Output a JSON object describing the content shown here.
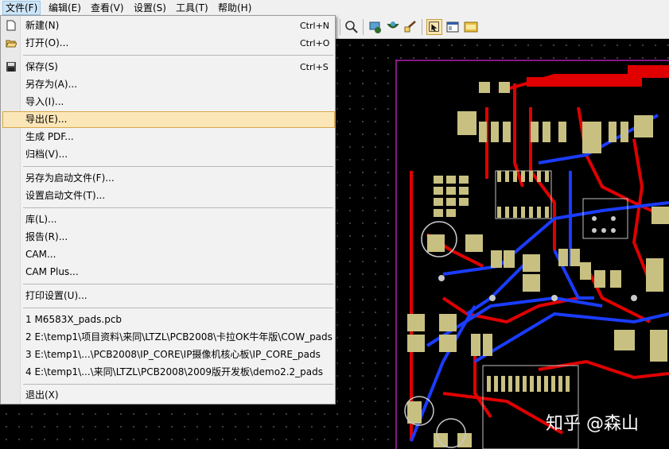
{
  "menubar": {
    "items": [
      {
        "label": "文件(F)"
      },
      {
        "label": "编辑(E)"
      },
      {
        "label": "查看(V)"
      },
      {
        "label": "设置(S)"
      },
      {
        "label": "工具(T)"
      },
      {
        "label": "帮助(H)"
      }
    ]
  },
  "file_menu": {
    "new": {
      "label": "新建(N)",
      "shortcut": "Ctrl+N"
    },
    "open": {
      "label": "打开(O)...",
      "shortcut": "Ctrl+O"
    },
    "save": {
      "label": "保存(S)",
      "shortcut": "Ctrl+S"
    },
    "save_as": {
      "label": "另存为(A)..."
    },
    "import": {
      "label": "导入(I)..."
    },
    "export": {
      "label": "导出(E)..."
    },
    "generate_pdf": {
      "label": "生成 PDF..."
    },
    "archive": {
      "label": "归档(V)..."
    },
    "save_as_startup": {
      "label": "另存为启动文件(F)..."
    },
    "set_startup": {
      "label": "设置启动文件(T)..."
    },
    "library": {
      "label": "库(L)..."
    },
    "reports": {
      "label": "报告(R)..."
    },
    "cam": {
      "label": "CAM..."
    },
    "cam_plus": {
      "label": "CAM Plus..."
    },
    "print_setup": {
      "label": "打印设置(U)..."
    },
    "recent": [
      "1 M6583X_pads.pcb",
      "2 E:\\temp1\\项目资料\\来同\\LTZL\\PCB2008\\卡拉OK牛年版\\COW_pads",
      "3 E:\\temp1\\...\\PCB2008\\IP_CORE\\IP摄像机核心板\\IP_CORE_pads",
      "4 E:\\temp1\\...\\来同\\LTZL\\PCB2008\\2009版开发板\\demo2.2_pads"
    ],
    "exit": {
      "label": "退出(X)"
    }
  },
  "watermark": "知乎 @森山",
  "colors": {
    "board_bg": "#000000",
    "trace_red": "#e00000",
    "trace_blue": "#1a3cff",
    "pad": "#c8c080",
    "highlight": "#fbe6b8"
  }
}
